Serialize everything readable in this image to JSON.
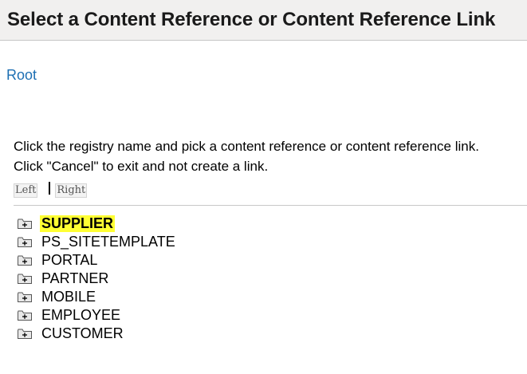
{
  "header": {
    "title": "Select a Content Reference or Content Reference Link"
  },
  "breadcrumb": {
    "root_label": "Root"
  },
  "instructions": {
    "line1": "Click the registry name and pick a content reference or content reference link.",
    "line2": "Click \"Cancel\" to exit and not create a link."
  },
  "nav": {
    "left_label": "Left",
    "right_label": "Right"
  },
  "tree": {
    "items": [
      {
        "label": "SUPPLIER",
        "selected": true,
        "icon": "folder-expand-icon"
      },
      {
        "label": "PS_SITETEMPLATE",
        "selected": false,
        "icon": "folder-expand-icon"
      },
      {
        "label": "PORTAL",
        "selected": false,
        "icon": "folder-expand-icon"
      },
      {
        "label": "PARTNER",
        "selected": false,
        "icon": "folder-expand-icon"
      },
      {
        "label": "MOBILE",
        "selected": false,
        "icon": "folder-expand-icon"
      },
      {
        "label": "EMPLOYEE",
        "selected": false,
        "icon": "folder-expand-icon"
      },
      {
        "label": "CUSTOMER",
        "selected": false,
        "icon": "folder-expand-icon"
      }
    ]
  },
  "colors": {
    "header_bg": "#f1f0ef",
    "link": "#1d6fb3",
    "highlight": "#ffff33",
    "divider": "#c8c8c8"
  }
}
